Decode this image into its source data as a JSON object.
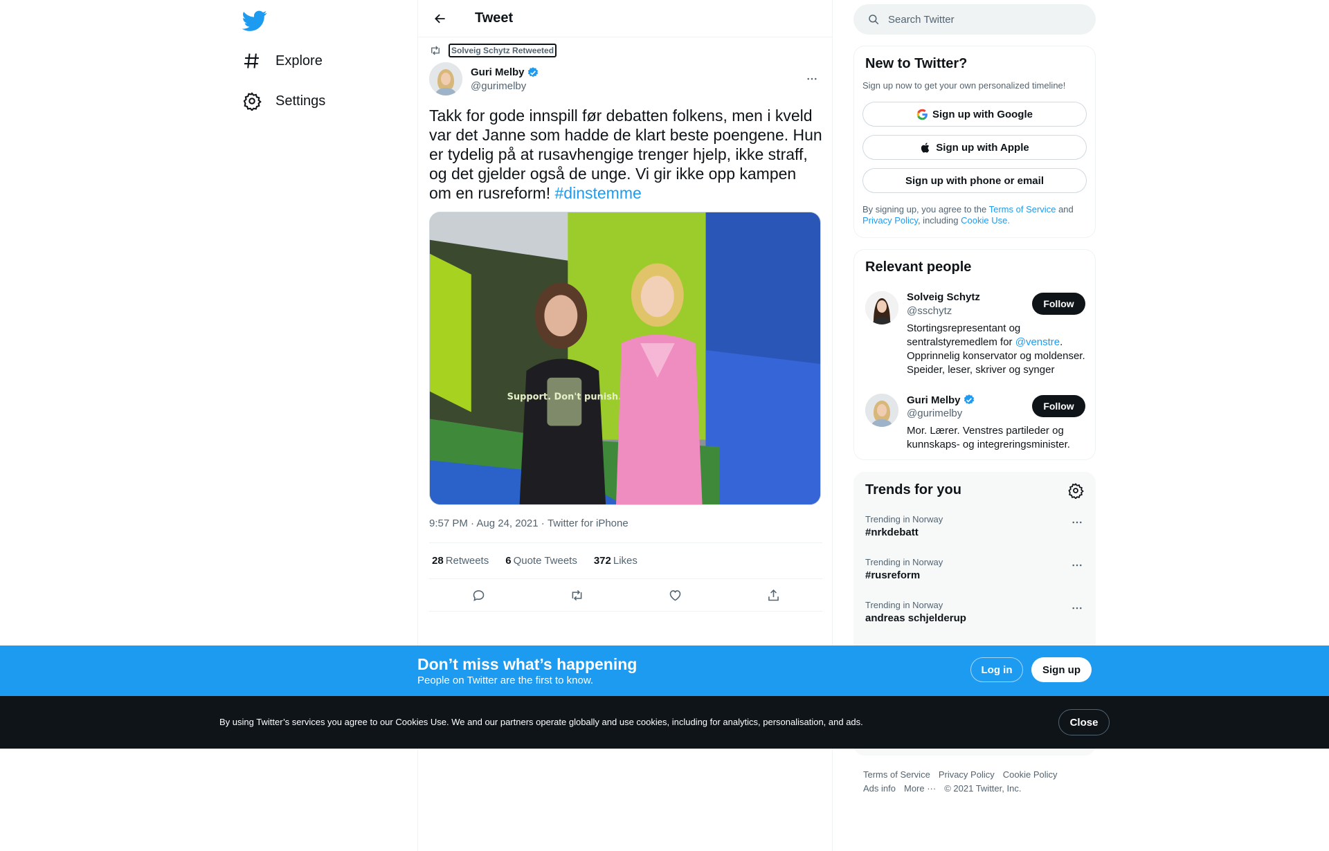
{
  "nav": {
    "logo_icon": "twitter-bird-icon",
    "items": [
      {
        "icon": "hashtag-icon",
        "label": "Explore"
      },
      {
        "icon": "gear-icon",
        "label": "Settings"
      }
    ]
  },
  "header": {
    "title": "Tweet"
  },
  "tweet": {
    "retweeted_by": "Solveig Schytz Retweeted",
    "author_name": "Guri Melby",
    "author_handle": "@gurimelby",
    "text": "Takk for gode innspill før debatten folkens, men i kveld var det Janne som hadde de klart beste poengene. Hun er tydelig på at rusavhengige trenger hjelp, ikke straff, og det gjelder også de unge. Vi gir ikke opp kampen om en rusreform!",
    "hashtag": "#dinstemme",
    "media_caption_text": "Support. Don't punish.",
    "time": "9:57 PM · Aug 24, 2021",
    "source": "Twitter for iPhone",
    "retweets_count": "28",
    "retweets_label": "Retweets",
    "quote_count": "6",
    "quote_label": "Quote Tweets",
    "likes_count": "372",
    "likes_label": "Likes"
  },
  "search": {
    "placeholder": "Search Twitter"
  },
  "new_to_twitter": {
    "title": "New to Twitter?",
    "subtitle": "Sign up now to get your own personalized timeline!",
    "google": "Sign up with Google",
    "apple": "Sign up with Apple",
    "phone": "Sign up with phone or email",
    "legal_prefix": "By signing up, you agree to the",
    "tos": "Terms of Service",
    "and": "and",
    "privacy": "Privacy Policy",
    "including": ", including",
    "cookie": "Cookie Use."
  },
  "relevant_people": {
    "title": "Relevant people",
    "people": [
      {
        "name": "Solveig Schytz",
        "handle": "@sschytz",
        "bio_before": "Stortingsrepresentant og sentralstyremedlem for ",
        "bio_link": "@venstre",
        "bio_after": ". Opprinnelig konservator og moldenser. Speider, leser, skriver og synger",
        "follow": "Follow"
      },
      {
        "name": "Guri Melby",
        "handle": "@gurimelby",
        "bio": "Mor. Lærer. Venstres partileder og kunnskaps- og integreringsminister.",
        "follow": "Follow"
      }
    ]
  },
  "trends": {
    "title": "Trends for you",
    "items": [
      {
        "context": "Trending in Norway",
        "name": "#nrkdebatt"
      },
      {
        "context": "Trending in Norway",
        "name": "#rusreform"
      },
      {
        "context": "Trending in Norway",
        "name": "andreas schjelderup"
      }
    ]
  },
  "footer": {
    "terms": "Terms of Service",
    "privacy": "Privacy Policy",
    "cookie": "Cookie Policy",
    "ads": "Ads info",
    "more": "More ···",
    "copyright": "© 2021 Twitter, Inc."
  },
  "banner": {
    "title": "Don’t miss what’s happening",
    "subtitle": "People on Twitter are the first to know.",
    "login": "Log in",
    "signup": "Sign up"
  },
  "cookie_bar": {
    "text": "By using Twitter’s services you agree to our Cookies Use. We and our partners operate globally and use cookies, including for analytics, personalisation, and ads.",
    "close": "Close"
  },
  "colors": {
    "accent": "#1d9bf0",
    "text": "#0f1419",
    "muted": "#536471"
  }
}
